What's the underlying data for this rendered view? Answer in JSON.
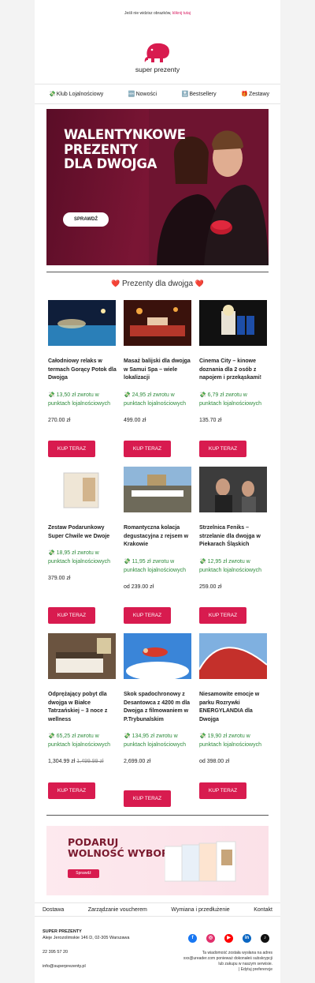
{
  "preheader": {
    "text": "Jeśli nie widzisz obrazków,",
    "link": "kliknij tutaj"
  },
  "brand": {
    "name": "super prezenty",
    "accent": "#d81b4f"
  },
  "nav": [
    {
      "icon": "💸",
      "label": "Klub Lojalnościowy"
    },
    {
      "icon": "🆕",
      "label": "Nowości"
    },
    {
      "icon": "🔝",
      "label": "Bestsellery"
    },
    {
      "icon": "🎁",
      "label": "Zestawy"
    }
  ],
  "hero": {
    "title_lines": [
      "WALENTYNKOWE",
      "PREZENTY",
      "DLA DWOJGA"
    ],
    "button": "SPRAWDŹ"
  },
  "section": {
    "heart": "❤️",
    "title": "Prezenty dla dwojga"
  },
  "buy_label": "KUP TERAZ",
  "products": [
    {
      "title": "Całodniowy relaks w termach Gorący Potok dla Dwojga",
      "cashback": "💸 13,50 zł zwrotu w punktach lojalnościowych",
      "price": "270.00 zł",
      "old_price": ""
    },
    {
      "title": "Masaż balijski dla dwojga w Samui Spa – wiele lokalizacji",
      "cashback": "💸 24,95 zł zwrotu w punktach lojalnościowych",
      "price": "499.00 zł",
      "old_price": ""
    },
    {
      "title": "Cinema City – kinowe doznania dla 2 osób z napojem i przekąskami!",
      "cashback": "💸 6,79 zł zwrotu w punktach lojalnościowych",
      "price": "135.70 zł",
      "old_price": ""
    },
    {
      "title": "Zestaw Podarunkowy Super Chwile we Dwoje",
      "cashback": "💸 18,95 zł zwrotu w punktach lojalnościowych",
      "price": "379.00 zł",
      "old_price": ""
    },
    {
      "title": "Romantyczna kolacja degustacyjna z rejsem w Krakowie",
      "cashback": "💸 11,95 zł zwrotu w punktach lojalnościowych",
      "price": "od 239.00 zł",
      "old_price": ""
    },
    {
      "title": "Strzelnica Feniks – strzelanie dla dwojga w Piekarach Śląskich",
      "cashback": "💸 12,95 zł zwrotu w punktach lojalnościowych",
      "price": "259.00 zł",
      "old_price": ""
    },
    {
      "title": "Odprężający pobyt dla dwojga w Białce Tatrzańskiej – 3 noce z wellness",
      "cashback": "💸 65,25 zł zwrotu w punktach lojalnościowych",
      "price": "1,304.99 zł",
      "old_price": "1,499.99 zł"
    },
    {
      "title": "Skok spadochronowy z Desantowca z 4200 m dla Dwojga z filmowaniem w P.Trybunalskim",
      "cashback": "💸 134,95 zł zwrotu w punktach lojalnościowych",
      "price": "2,699.00 zł",
      "old_price": ""
    },
    {
      "title": "Niesamowite emocje w parku Rozrywki ENERGYLANDIA dla Dwojga",
      "cashback": "💸 19,90 zł zwrotu w punktach lojalnościowych",
      "price": "od 398.00 zł",
      "old_price": ""
    }
  ],
  "banner": {
    "title_lines": [
      "PODARUJ",
      "WOLNOŚĆ WYBORU!"
    ],
    "button": "Sprawdź"
  },
  "footer_links": [
    "Dostawa",
    "Zarządzanie voucherem",
    "Wymiana i przedłużenie",
    "Kontakt"
  ],
  "footer": {
    "company": "SUPER PREZENTY",
    "address": "Aleje Jerozolimskie 146 D, 02-305 Warszawa",
    "phone": "22 395 57 20",
    "email": "info@superprezenty.pl",
    "notice_lines": [
      "Ta wiadomość została wysłana na adres",
      "xxx@ureader.com ponieważ dokonałeś subskrypcji",
      "lub zakupu w naszym serwisie.",
      "| Edytuj preferencje"
    ]
  },
  "social": [
    {
      "icon": "facebook-icon",
      "glyph": "f",
      "color": "#1877f2"
    },
    {
      "icon": "instagram-icon",
      "glyph": "◎",
      "color": "#e1306c"
    },
    {
      "icon": "youtube-icon",
      "glyph": "▶",
      "color": "#ff0000"
    },
    {
      "icon": "linkedin-icon",
      "glyph": "in",
      "color": "#0a66c2"
    },
    {
      "icon": "tiktok-icon",
      "glyph": "♪",
      "color": "#111111"
    }
  ]
}
